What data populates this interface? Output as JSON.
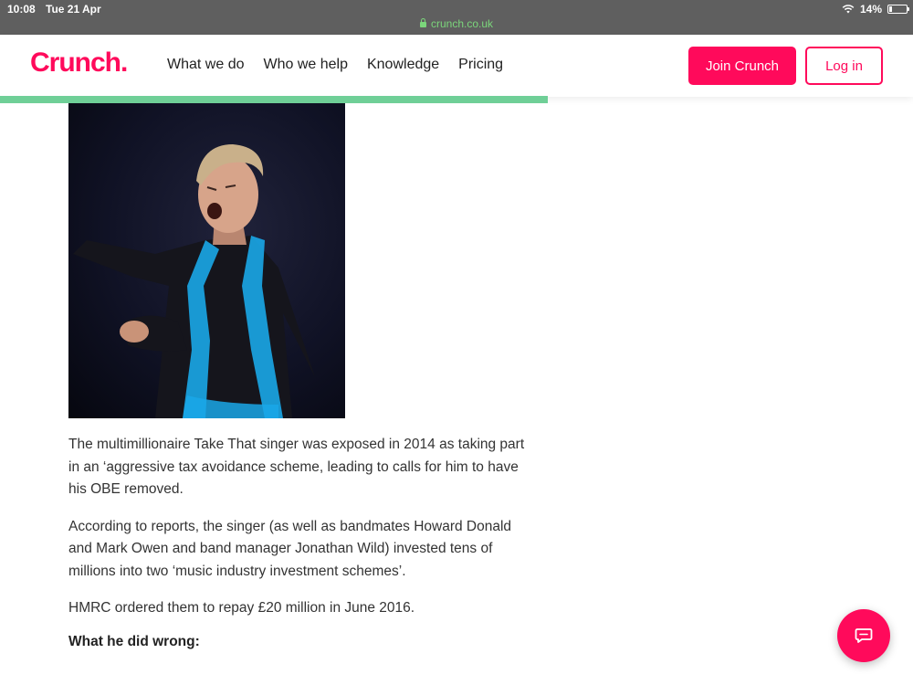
{
  "status_bar": {
    "time": "10:08",
    "date": "Tue 21 Apr",
    "battery": "14%",
    "battery_level": 0.14,
    "url": "crunch.co.uk"
  },
  "header": {
    "logo": "Crunch.",
    "nav": [
      "What we do",
      "Who we help",
      "Knowledge",
      "Pricing"
    ],
    "join_label": "Join Crunch",
    "login_label": "Log in",
    "brand_color": "#ff0a5b",
    "reading_progress": 0.6
  },
  "article": {
    "paragraphs": [
      "The multimillionaire Take That singer was exposed in 2014 as taking part in an ‘aggressive tax avoidance scheme, leading to calls for him to have his OBE removed.",
      "According to reports, the singer (as well as bandmates Howard Donald and Mark Owen and band manager Jonathan Wild) invested tens of millions into two ‘music industry investment schemes’.",
      "HMRC ordered them to repay £20 million in June 2016."
    ],
    "subheading": "What he did wrong:"
  },
  "chat": {
    "icon": "chat-bubble-icon"
  }
}
